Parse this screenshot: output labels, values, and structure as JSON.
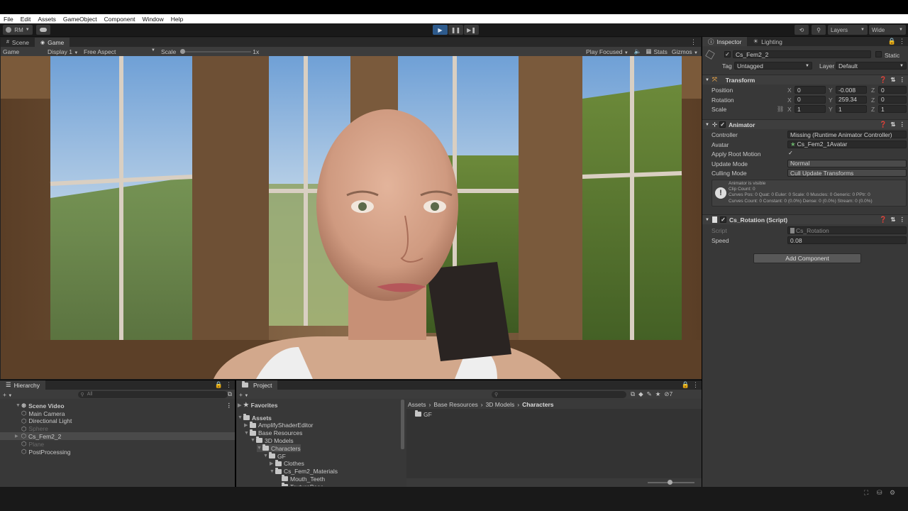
{
  "menu": [
    "File",
    "Edit",
    "Assets",
    "GameObject",
    "Component",
    "Window",
    "Help"
  ],
  "toolbar": {
    "account": "RM",
    "cloud": "cloud-icon",
    "layers": "Layers",
    "layout": "Wide"
  },
  "scene_panel": {
    "tabs": [
      "Scene",
      "Game"
    ],
    "sub": {
      "mode": "Game",
      "display": "Display 1",
      "aspect": "Free Aspect",
      "scale_label": "Scale",
      "scale_value": "1x",
      "play_focused": "Play Focused",
      "stats": "Stats",
      "gizmos": "Gizmos"
    }
  },
  "inspector": {
    "tabs": [
      "Inspector",
      "Lighting"
    ],
    "object_name": "Cs_Fem2_2",
    "static_label": "Static",
    "tag_label": "Tag",
    "tag_value": "Untagged",
    "layer_label": "Layer",
    "layer_value": "Default",
    "transform": {
      "title": "Transform",
      "rows": [
        {
          "label": "Position",
          "x": "0",
          "y": "-0.008",
          "z": "0"
        },
        {
          "label": "Rotation",
          "x": "0",
          "y": "259.34",
          "z": "0"
        },
        {
          "label": "Scale",
          "x": "1",
          "y": "1",
          "z": "1"
        }
      ],
      "axes": [
        "X",
        "Y",
        "Z"
      ]
    },
    "animator": {
      "title": "Animator",
      "rows": [
        {
          "label": "Controller",
          "value": "Missing (Runtime Animator Controller)"
        },
        {
          "label": "Avatar",
          "value": "Cs_Fem2_1Avatar"
        },
        {
          "label": "Apply Root Motion",
          "value": "✓"
        },
        {
          "label": "Update Mode",
          "value": "Normal"
        },
        {
          "label": "Culling Mode",
          "value": "Cull Update Transforms"
        }
      ],
      "info": [
        "Animator is visible",
        "Clip Count: 0",
        "Curves Pos: 0 Quat: 0 Euler: 0 Scale: 0 Muscles: 0 Generic: 0 PPtr: 0",
        "Curves Count: 0 Constant: 0 (0.0%) Dense: 0 (0.0%) Stream: 0 (0.0%)"
      ]
    },
    "script": {
      "title": "Cs_Rotation (Script)",
      "script_label": "Script",
      "script_value": "Cs_Rotation",
      "speed_label": "Speed",
      "speed_value": "0.08"
    },
    "add_component": "Add Component"
  },
  "hierarchy": {
    "tab": "Hierarchy",
    "search_placeholder": "All",
    "scene": "Scene Video",
    "items": [
      "Main Camera",
      "Directional Light",
      "Sphere",
      "Cs_Fem2_2",
      "Plane",
      "PostProcessing"
    ]
  },
  "project": {
    "tab": "Project",
    "favorites": "Favorites",
    "tree": [
      "Assets",
      "AmplifyShaderEditor",
      "Base Resources",
      "3D Models",
      "Characters",
      "GF",
      "Clothes",
      "Cs_Fem2_Materials",
      "Mouth_Teeth",
      "TextureBase"
    ],
    "breadcrumb": [
      "Assets",
      "Base Resources",
      "3D Models",
      "Characters"
    ],
    "content": [
      "GF"
    ],
    "hidden_count": "7"
  }
}
